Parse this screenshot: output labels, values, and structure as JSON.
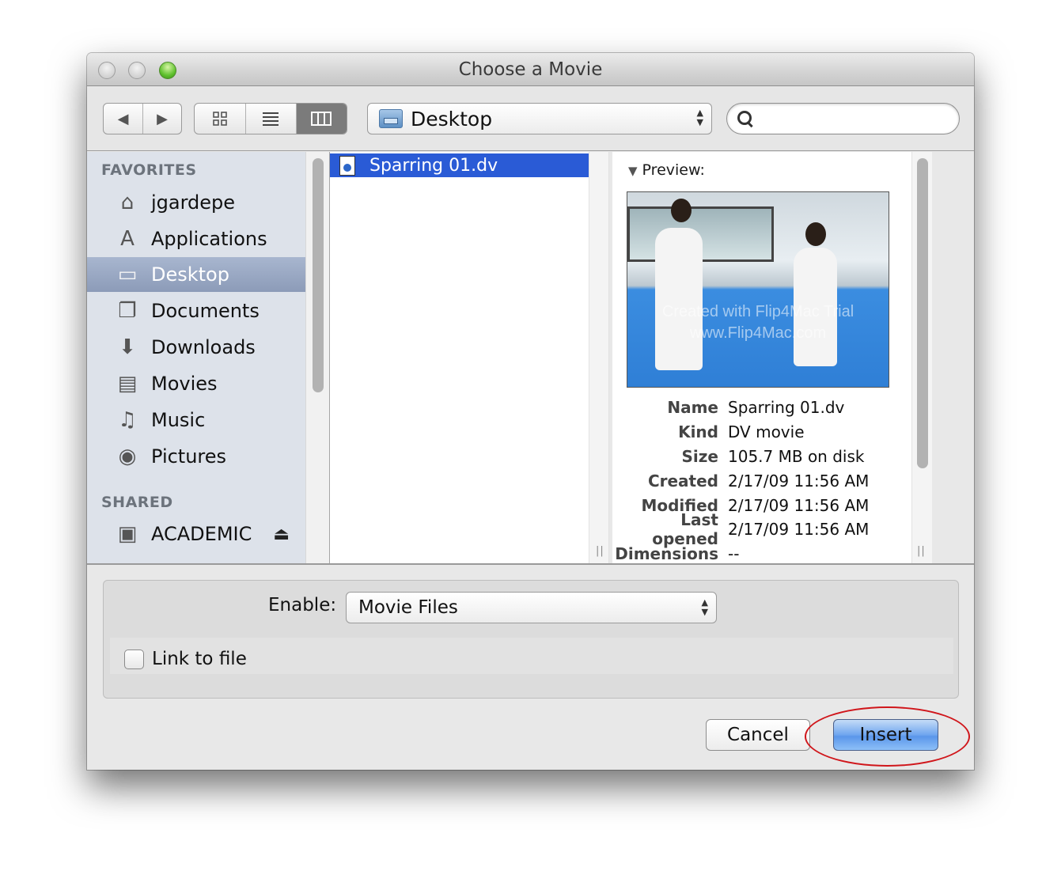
{
  "window": {
    "title": "Choose a Movie"
  },
  "toolbar": {
    "back_glyph": "◀",
    "forward_glyph": "▶",
    "view_modes": [
      {
        "name": "icon-view",
        "glyph": "▫▫",
        "active": false
      },
      {
        "name": "list-view",
        "glyph": "≡",
        "active": false
      },
      {
        "name": "column-view",
        "glyph": "▥",
        "active": true
      }
    ],
    "location": "Desktop",
    "search_placeholder": "",
    "search_value": ""
  },
  "sidebar": {
    "favorites_header": "FAVORITES",
    "favorites": [
      {
        "label": "jgardepe",
        "icon": "home-icon",
        "glyph": "⌂",
        "selected": false
      },
      {
        "label": "Applications",
        "icon": "applications-icon",
        "glyph": "A",
        "selected": false
      },
      {
        "label": "Desktop",
        "icon": "desktop-icon",
        "glyph": "▭",
        "selected": true
      },
      {
        "label": "Documents",
        "icon": "documents-icon",
        "glyph": "❐",
        "selected": false
      },
      {
        "label": "Downloads",
        "icon": "downloads-icon",
        "glyph": "⬇",
        "selected": false
      },
      {
        "label": "Movies",
        "icon": "movies-icon",
        "glyph": "▤",
        "selected": false
      },
      {
        "label": "Music",
        "icon": "music-icon",
        "glyph": "♫",
        "selected": false
      },
      {
        "label": "Pictures",
        "icon": "pictures-icon",
        "glyph": "◉",
        "selected": false
      }
    ],
    "shared_header": "SHARED",
    "shared": [
      {
        "label": "ACADEMIC",
        "icon": "computer-icon",
        "glyph": "▣",
        "eject": "⏏"
      }
    ]
  },
  "browser": {
    "files": [
      {
        "name": "Sparring 01.dv",
        "selected": true
      }
    ]
  },
  "preview": {
    "header": "Preview:",
    "watermark_line1": "Created with Flip4Mac Trial",
    "watermark_line2": "www.Flip4Mac.com",
    "info": [
      {
        "key": "Name",
        "value": "Sparring 01.dv"
      },
      {
        "key": "Kind",
        "value": "DV movie"
      },
      {
        "key": "Size",
        "value": "105.7 MB on disk"
      },
      {
        "key": "Created",
        "value": "2/17/09 11:56 AM"
      },
      {
        "key": "Modified",
        "value": "2/17/09 11:56 AM"
      },
      {
        "key": "Last opened",
        "value": "2/17/09 11:56 AM"
      },
      {
        "key": "Dimensions",
        "value": "--"
      }
    ]
  },
  "options": {
    "enable_label": "Enable:",
    "enable_value": "Movie Files",
    "link_to_file_label": "Link to file",
    "link_to_file_checked": false
  },
  "buttons": {
    "cancel": "Cancel",
    "insert": "Insert"
  },
  "annotation": {
    "highlight_color": "#d0161b",
    "target": "Insert"
  }
}
